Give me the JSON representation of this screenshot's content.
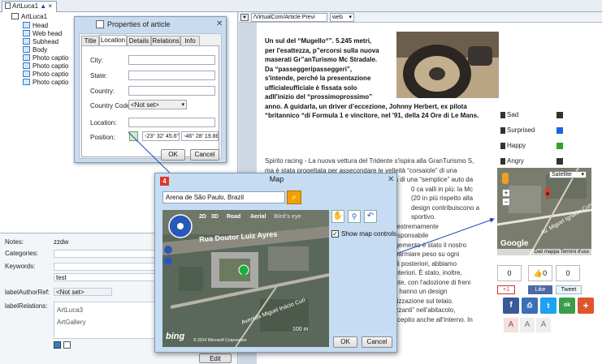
{
  "document_tab": {
    "label": "ArtLuca1"
  },
  "tree": {
    "root": "ArtLuca1",
    "items": [
      "Head",
      "Web head",
      "Subhead",
      "Body",
      "Photo captio",
      "Photo captio",
      "Photo captio",
      "Photo captio"
    ]
  },
  "properties_panel": {
    "notes_label": "Notes:",
    "notes_value": "zzdw",
    "categories_label": "Categories:",
    "keywords_label": "Keywords:",
    "keywords_value": "test",
    "author_ref_label": "labelAuthorRef:",
    "author_ref_value": "<Not set>",
    "relations_label": "labelRelations:",
    "relations": [
      "ArtLuca3",
      "ArtGallery"
    ]
  },
  "properties_dialog": {
    "title": "Properties of article",
    "tabs": [
      "Title",
      "Location",
      "Details",
      "Relations",
      "Info"
    ],
    "active_tab": "Location",
    "city_label": "City:",
    "state_label": "State:",
    "country_label": "Country:",
    "country_code_label": "Country Code:",
    "country_code_value": "<Not set>",
    "location_label": "Location:",
    "position_label": "Position:",
    "latitude": "-23° 32' 45.6\"",
    "longitude": "-46° 28' 19.88\"",
    "ok_label": "OK",
    "cancel_label": "Cancel"
  },
  "web": {
    "address": "/VirtualCom/Article Previ",
    "view_mode": "web",
    "headline": [
      "Un sul del “Mugello“”. 5.245 metri,",
      "per l'esattezza, p”ercorsi sulla nuova",
      "maserati Gr”anTurismo Mc Stradale.",
      "Da “passeggeripasseggeri”,",
      "s'intende, perché la presentazione",
      "ufficialeufficiale è fissata solo",
      "adll'inizio del “prossimoprossimo”",
      "anno. A guidarla, un driver d’eccezione, Johnny Herbert, ex pilota",
      "“britannico “di Formula 1 e vincitore, nel '91, della 24 Ore di Le Mans."
    ],
    "body_lines": [
      "Spirito racing - La nuova vettura del Tridente s'ispira alla GranTurismo S,",
      "ma è stata progettata per assecondare le velleità “corsaiole” di una",
      "certa clientela esigente, che non si accontenta di una “semplice” auto da",
      "0 ca valli in più: la Mc",
      "(20 in più rispetto alla",
      "design contribuiscono a",
      "sportivo.",
      "o estremamente",
      "responsabile",
      "ngemento è stato il nostro",
      "sparmiare peso su ogni",
      "dili posteriori, abbiamo",
      "anteriori. È stato, inoltre,",
      "ante, con l'adozione di freni",
      "e” hanno un design",
      "mizzazione sul telaio.",
      "rizzanti” nell'abitacolo,",
      "recepito anche all'interno. In"
    ],
    "reactions": [
      {
        "label": "Sad",
        "color": "#333333"
      },
      {
        "label": "Surprised",
        "color": "#1a66d9"
      },
      {
        "label": "Happy",
        "color": "#2aa52a"
      },
      {
        "label": "Angry",
        "color": "#333333"
      }
    ],
    "mini_map": {
      "type_label": "Satellite",
      "street": "Av. Miguel Ignacio Curi",
      "brand": "Google",
      "footer": "Dati mappa   Termini d'uso"
    },
    "counts": [
      "0",
      "0",
      "0"
    ],
    "gplus": "+1",
    "like_label": "Like",
    "tweet_label": "Tweet",
    "font_buttons": [
      "A",
      "A",
      "A"
    ]
  },
  "map_dialog": {
    "title": "Map",
    "search_value": "Arena de São Paulo, Brazil",
    "view_modes": [
      "2D",
      "3D",
      "Road",
      "Aerial",
      "Bird's eye"
    ],
    "show_controls_label": "Show map controls",
    "street_1": "Rua Doutor Luiz Ayres",
    "street_2": "Avenida Miguel Inácio Curi",
    "scale": "100 m",
    "brand": "bing",
    "copyright": "© 2014 Microsoft Corporation",
    "ok_label": "OK",
    "cancel_label": "Cancel"
  },
  "edit_button": "Edit"
}
